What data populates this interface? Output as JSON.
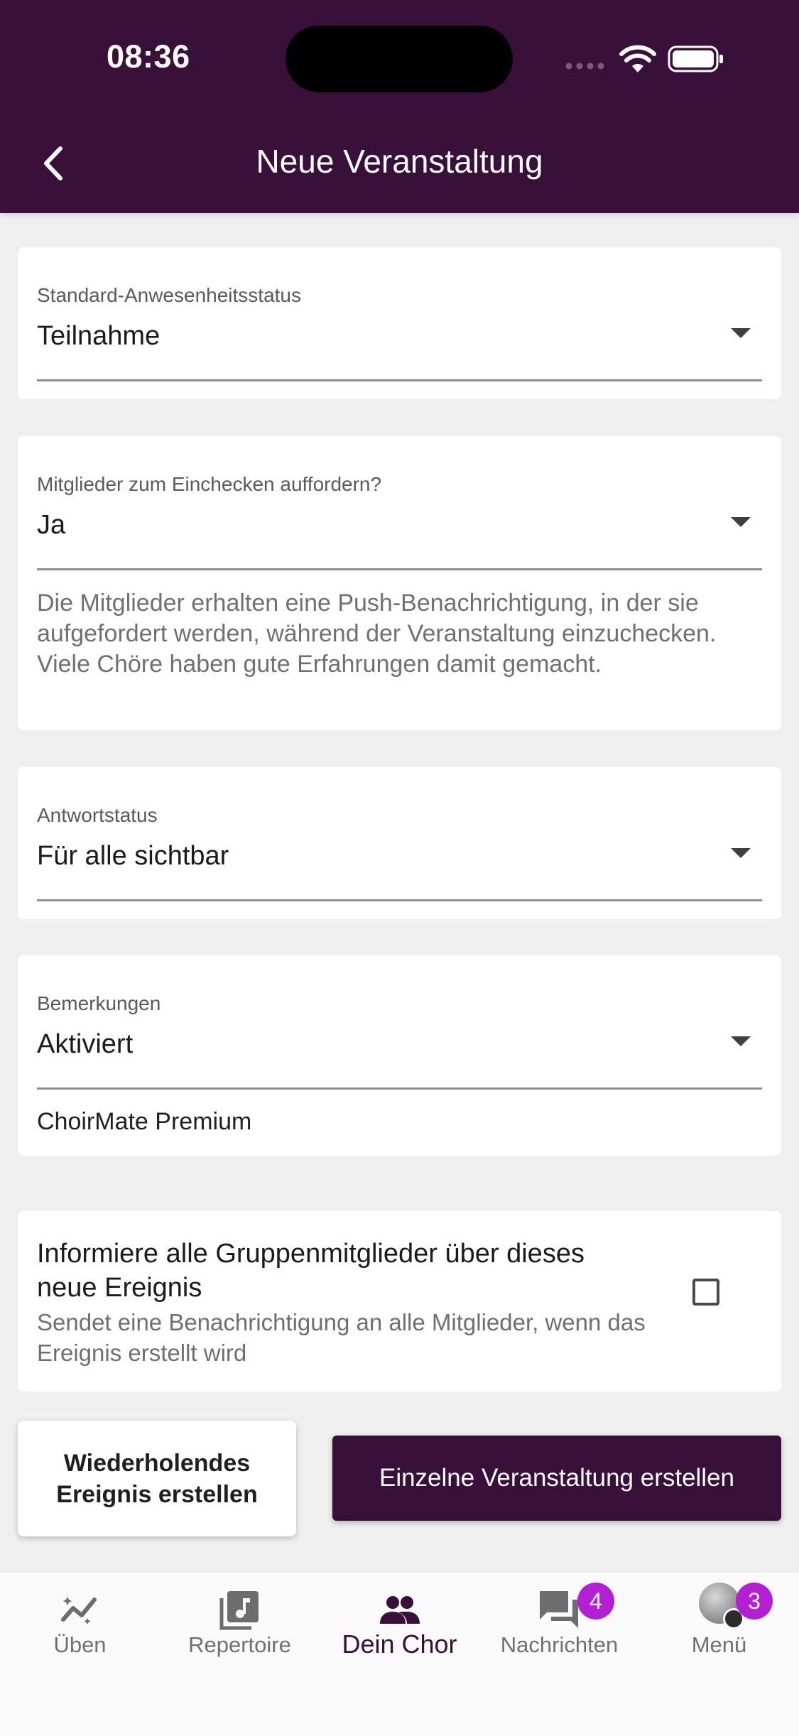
{
  "status_bar": {
    "time": "08:36"
  },
  "header": {
    "title": "Neue Veranstaltung",
    "back_icon": "chevron-left-icon"
  },
  "form": {
    "attendance": {
      "label": "Standard-Anwesenheitsstatus",
      "value": "Teilnahme"
    },
    "checkin": {
      "label": "Mitglieder zum Einchecken auffordern?",
      "value": "Ja",
      "helper": "Die Mitglieder erhalten eine Push-Benachrichtigung, in der sie aufgefordert werden, während der Veranstaltung einzuchecken. Viele Chöre haben gute Erfahrungen damit gemacht."
    },
    "answer_status": {
      "label": "Antwortstatus",
      "value": "Für alle sichtbar"
    },
    "remarks": {
      "label": "Bemerkungen",
      "value": "Aktiviert",
      "note": "ChoirMate Premium"
    },
    "notify": {
      "title": "Informiere alle Gruppenmitglieder über dieses neue Ereignis",
      "subtitle": "Sendet eine Benachrichtigung an alle Mitglieder, wenn das Ereignis erstellt wird",
      "checked": false
    }
  },
  "actions": {
    "repeat_label": "Wiederholendes Ereignis erstellen",
    "single_label": "Einzelne Veranstaltung erstellen"
  },
  "bottom_nav": {
    "items": [
      {
        "label": "Üben",
        "icon": "practice-trend-icon"
      },
      {
        "label": "Repertoire",
        "icon": "music-note-icon"
      },
      {
        "label": "Dein Chor",
        "icon": "group-icon",
        "active": true
      },
      {
        "label": "Nachrichten",
        "icon": "chat-icon",
        "badge": "4"
      },
      {
        "label": "Menü",
        "icon": "avatar-menu-icon",
        "badge": "3"
      }
    ]
  },
  "colors": {
    "primary": "#38103a",
    "badge": "#b41fd6",
    "background": "#efefef"
  }
}
